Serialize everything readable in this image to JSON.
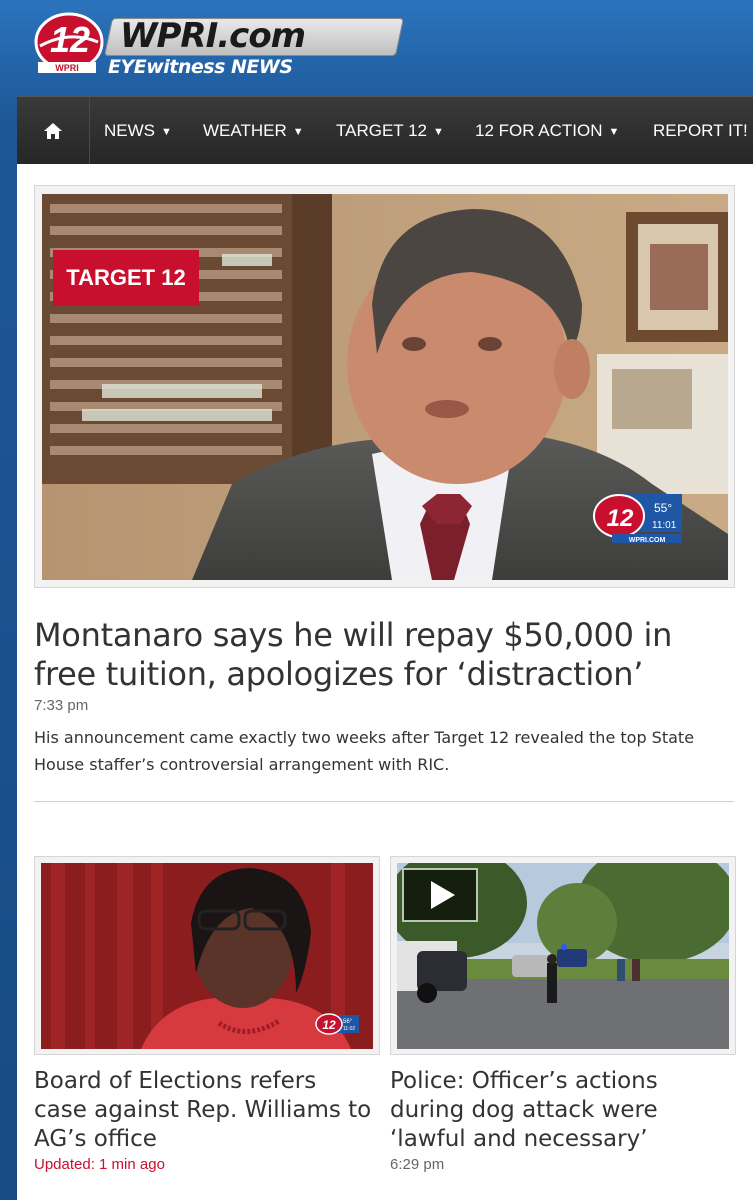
{
  "brand": {
    "channel_number": "12",
    "badge_text": "WPRI",
    "site_name": "WPRI.com",
    "tagline": "EYEwitness NEWS"
  },
  "nav": {
    "home_icon": "home-icon",
    "items": [
      {
        "label": "NEWS",
        "has_dropdown": true
      },
      {
        "label": "WEATHER",
        "has_dropdown": true
      },
      {
        "label": "TARGET 12",
        "has_dropdown": true
      },
      {
        "label": "12 FOR ACTION",
        "has_dropdown": true
      },
      {
        "label": "REPORT IT!",
        "has_dropdown": false
      }
    ]
  },
  "hero": {
    "tag": "TARGET 12",
    "headline": "Montanaro says he will repay $50,000 in free tuition, apologizes for ‘distraction’",
    "time": "7:33 pm",
    "summary": "His announcement came exactly two weeks after Target 12 revealed the top State House staffer’s controversial arrangement with RIC.",
    "bug": {
      "channel": "12",
      "temp": "55°",
      "clock": "11:01",
      "site": "WPRI.COM"
    }
  },
  "cards": [
    {
      "title": "Board of Elections refers case against Rep. Williams to AG’s office",
      "meta": "Updated: 1 min ago",
      "bug": {
        "channel": "12",
        "temp": "56°",
        "clock": "11:02"
      }
    },
    {
      "title": "Police: Officer’s actions during dog attack were ‘lawful and necessary’",
      "meta": "6:29 pm",
      "has_video": true
    }
  ],
  "colors": {
    "accent_red": "#c8102e",
    "nav_bg": "#2e2e2e",
    "page_blue": "#1d5796"
  }
}
